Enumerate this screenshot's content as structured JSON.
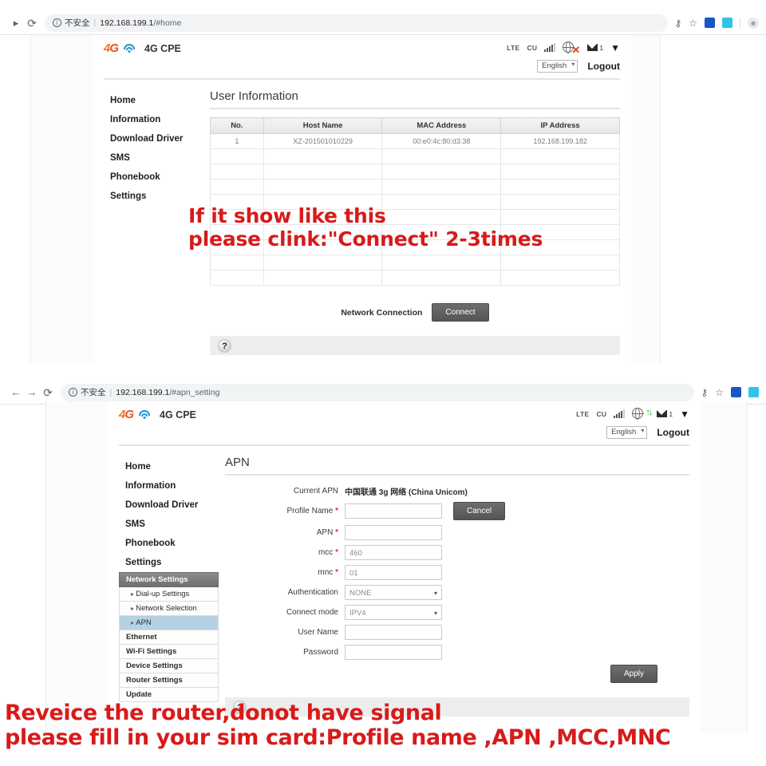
{
  "browser": {
    "back_icon": "▸",
    "forward_icon": "→",
    "reload_icon": "⟳",
    "info_icon": "i",
    "insecure_label": "不安全",
    "separator": "|",
    "key_icon": "⚷",
    "star_icon": "☆",
    "ext1_label": "",
    "ext2_label": "",
    "avatar_icon": "●",
    "tab1": {
      "back_icon": "▸",
      "url_host": "192.168.199.1",
      "url_path": "/#home"
    },
    "tab2": {
      "back_icon": "←",
      "forward_icon": "→",
      "url_host": "192.168.199.1",
      "url_path": "/#apn_setting"
    }
  },
  "router": {
    "brand_4g": "4G",
    "brand_4g_left": "4",
    "brand_4g_right": "G",
    "title": "4G CPE",
    "status": {
      "network_type": "LTE",
      "carrier": "CU",
      "signal_bars": 4,
      "mail_count": "1",
      "globe_state_page1": "disconnected",
      "globe_state_page2": "connected",
      "x_glyph": "✕",
      "updown_glyph": "↑↓"
    },
    "language": "English",
    "language_caret": "▾",
    "logout": "Logout",
    "menu": [
      {
        "label": "Home"
      },
      {
        "label": "Information"
      },
      {
        "label": "Download Driver"
      },
      {
        "label": "SMS"
      },
      {
        "label": "Phonebook"
      },
      {
        "label": "Settings"
      }
    ],
    "settings_submenu": [
      {
        "label": "Network Settings",
        "type": "group-header"
      },
      {
        "label": "Dial-up Settings",
        "type": "sub"
      },
      {
        "label": "Network Selection",
        "type": "sub"
      },
      {
        "label": "APN",
        "type": "sub",
        "active": true
      },
      {
        "label": "Ethernet",
        "type": "plain"
      },
      {
        "label": "Wi-Fi Settings",
        "type": "plain"
      },
      {
        "label": "Device Settings",
        "type": "plain"
      },
      {
        "label": "Router Settings",
        "type": "plain"
      },
      {
        "label": "Update",
        "type": "plain"
      }
    ],
    "help_icon": "?"
  },
  "page1": {
    "title": "User Information",
    "table": {
      "columns": [
        "No.",
        "Host Name",
        "MAC Address",
        "IP Address"
      ],
      "rows": [
        {
          "no": "1",
          "host": "XZ-201501010229",
          "mac": "00:e0:4c:80:d3:38",
          "ip": "192.168.199.182"
        }
      ],
      "empty_row_count": 9
    },
    "network_connection_label": "Network Connection",
    "connect_button": "Connect"
  },
  "page2": {
    "title": "APN",
    "current_apn_label": "Current APN",
    "current_apn_value": "中国联通 3g 网络 (China Unicom)",
    "fields": [
      {
        "label": "Profile Name",
        "required": true,
        "type": "input",
        "value": ""
      },
      {
        "label": "APN",
        "required": true,
        "type": "input",
        "value": ""
      },
      {
        "label": "mcc",
        "required": true,
        "type": "input",
        "value": "460"
      },
      {
        "label": "mnc",
        "required": true,
        "type": "input",
        "value": "01"
      },
      {
        "label": "Authentication",
        "required": false,
        "type": "select",
        "value": "NONE"
      },
      {
        "label": "Connect mode",
        "required": false,
        "type": "select",
        "value": "IPV4"
      },
      {
        "label": "User Name",
        "required": false,
        "type": "input",
        "value": ""
      },
      {
        "label": "Password",
        "required": false,
        "type": "input",
        "value": ""
      }
    ],
    "cancel_button": "Cancel",
    "apply_button": "Apply",
    "required_marker": "*"
  },
  "annotations": {
    "top": "If it show like this\nplease clink:\"Connect\" 2-3times",
    "bottom": "Reveice the router,donot have signal\nplease fill in your sim card:Profile name ,APN ,MCC,MNC",
    "color": "#d81a1a"
  }
}
